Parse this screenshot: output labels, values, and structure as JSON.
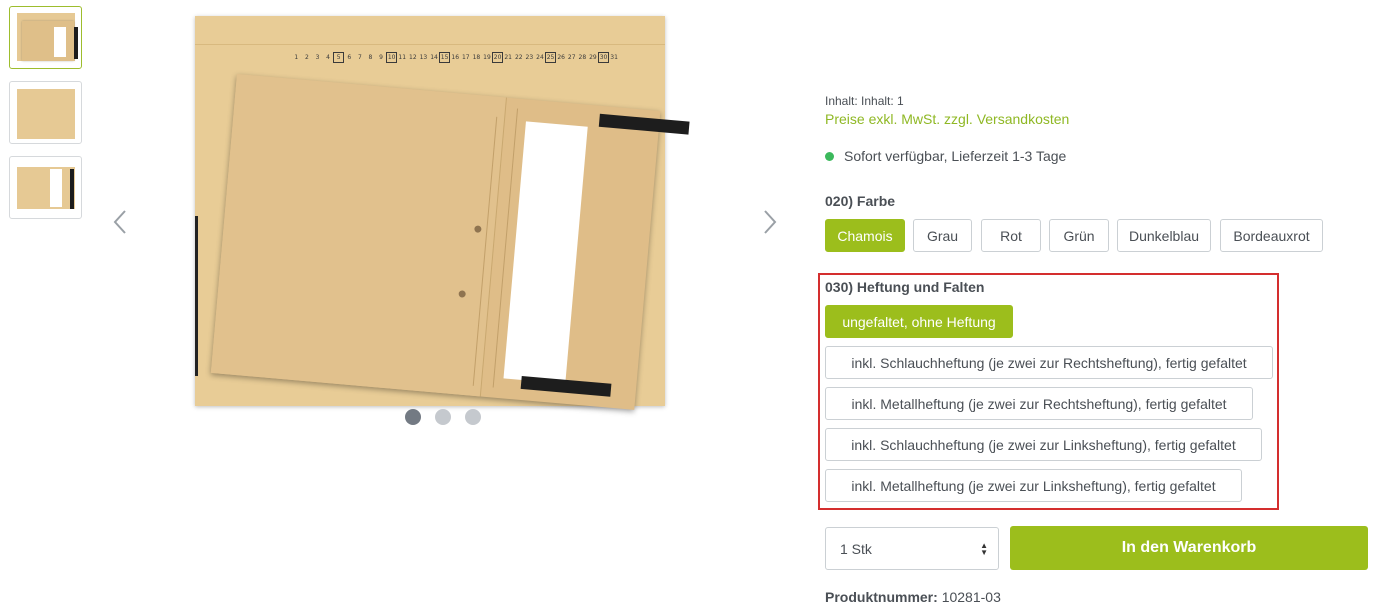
{
  "gallery": {
    "thumbnails": [
      {
        "name": "thumb-1",
        "active": true
      },
      {
        "name": "thumb-2",
        "active": false
      },
      {
        "name": "thumb-3",
        "active": false
      }
    ],
    "index_numbers": [
      "1",
      "2",
      "3",
      "4",
      "5",
      "6",
      "7",
      "8",
      "9",
      "10",
      "11",
      "12",
      "13",
      "14",
      "15",
      "16",
      "17",
      "18",
      "19",
      "20",
      "21",
      "22",
      "23",
      "24",
      "25",
      "26",
      "27",
      "28",
      "29",
      "30",
      "31"
    ],
    "prev_icon": "chevron-left-icon",
    "next_icon": "chevron-right-icon",
    "dots": 3,
    "active_dot": 0
  },
  "product": {
    "content_label": "Inhalt: Inhalt: 1",
    "price_note": "Preise exkl. MwSt. zzgl. Versandkosten",
    "availability": "Sofort verfügbar, Lieferzeit 1-3 Tage",
    "availability_color": "#3cb95c"
  },
  "color_group": {
    "label": "020) Farbe",
    "options": [
      "Chamois",
      "Grau",
      "Rot",
      "Grün",
      "Dunkelblau",
      "Bordeauxrot"
    ],
    "selected": "Chamois"
  },
  "binding_group": {
    "label": "030) Heftung und Falten",
    "options": [
      "ungefaltet, ohne Heftung",
      "inkl. Schlauchheftung (je zwei zur Rechtsheftung), fertig gefaltet",
      "inkl. Metallheftung (je zwei zur Rechtsheftung), fertig gefaltet",
      "inkl. Schlauchheftung (je zwei zur Linksheftung), fertig gefaltet",
      "inkl. Metallheftung (je zwei zur Linksheftung), fertig gefaltet"
    ],
    "selected": "ungefaltet, ohne Heftung",
    "highlight_color": "#d42e2e"
  },
  "purchase": {
    "quantity": "1 Stk",
    "add_to_cart": "In den Warenkorb",
    "product_number_label": "Produktnummer:",
    "product_number": "10281-03"
  },
  "colors": {
    "accent": "#9cbe1c",
    "text": "#4a4f55"
  }
}
